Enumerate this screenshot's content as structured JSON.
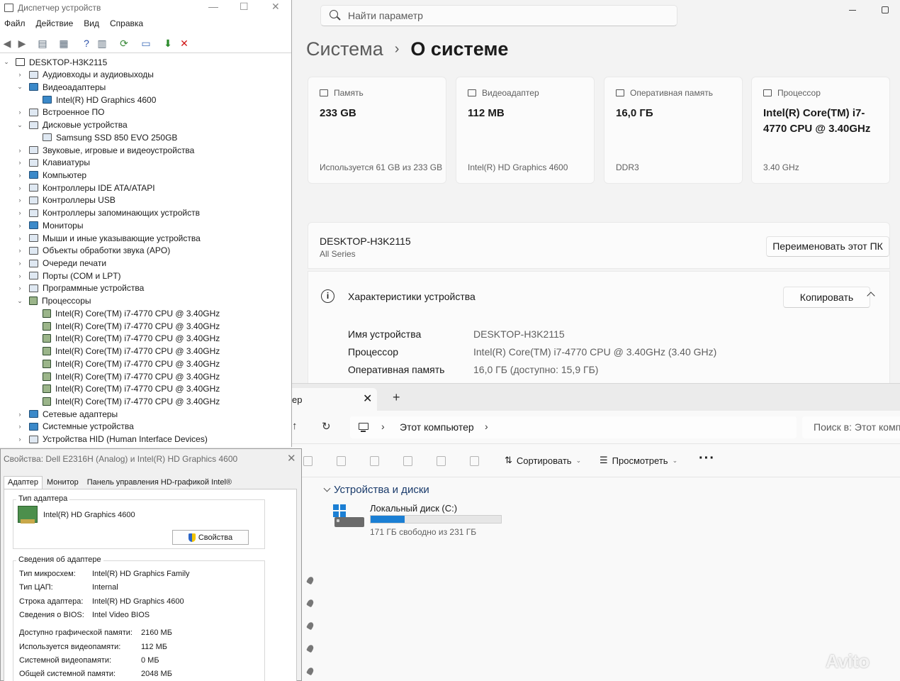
{
  "settings": {
    "search_placeholder": "Найти параметр",
    "breadcrumb_parent": "Система",
    "breadcrumb_sep": "›",
    "breadcrumb_current": "О системе",
    "cards": [
      {
        "label": "Память",
        "value": "233 GB",
        "sub": "Используется 61 GB из 233 GB"
      },
      {
        "label": "Видеоадаптер",
        "value": "112 MB",
        "sub": "Intel(R) HD Graphics 4600"
      },
      {
        "label": "Оперативная память",
        "value": "16,0 ГБ",
        "sub": "DDR3"
      },
      {
        "label": "Процессор",
        "value": "Intel(R) Core(TM) i7-4770 CPU @ 3.40GHz",
        "sub": "3.40 GHz"
      }
    ],
    "device_name": "DESKTOP-H3K2115",
    "device_series": "All Series",
    "rename_button": "Переименовать этот ПК",
    "specs_title": "Характеристики устройства",
    "copy_button": "Копировать",
    "specs": [
      {
        "key": "Имя устройства",
        "value": "DESKTOP-H3K2115"
      },
      {
        "key": "Процессор",
        "value": "Intel(R) Core(TM) i7-4770 CPU @ 3.40GHz (3.40 GHz)"
      },
      {
        "key": "Оперативная память",
        "value": "16,0 ГБ (доступно: 15,9 ГБ)"
      }
    ]
  },
  "explorer": {
    "tab_title": "ер",
    "path_item": "Этот компьютер",
    "search_placeholder": "Поиск в: Этот комп",
    "sort_label": "Сортировать",
    "view_label": "Просмотреть",
    "group_title": "Устройства и диски",
    "drive_name": "Локальный диск (C:)",
    "drive_free": "171 ГБ свободно из 231 ГБ",
    "drive_used_fraction": 0.26,
    "accent": "#1b7fd4"
  },
  "devmgr": {
    "title": "Диспетчер устройств",
    "menu": [
      "Файл",
      "Действие",
      "Вид",
      "Справка"
    ],
    "tree": [
      {
        "label": "DESKTOP-H3K2115",
        "indent": 0,
        "twisty": "v",
        "icon": "pc"
      },
      {
        "label": "Аудиовходы и аудиовыходы",
        "indent": 1,
        "twisty": ">",
        "icon": "gen"
      },
      {
        "label": "Видеоадаптеры",
        "indent": 1,
        "twisty": "v",
        "icon": "disp"
      },
      {
        "label": "Intel(R) HD Graphics 4600",
        "indent": 2,
        "twisty": "",
        "icon": "disp"
      },
      {
        "label": "Встроенное ПО",
        "indent": 1,
        "twisty": ">",
        "icon": "gen"
      },
      {
        "label": "Дисковые устройства",
        "indent": 1,
        "twisty": "v",
        "icon": "gen"
      },
      {
        "label": "Samsung SSD 850 EVO 250GB",
        "indent": 2,
        "twisty": "",
        "icon": "gen"
      },
      {
        "label": "Звуковые, игровые и видеоустройства",
        "indent": 1,
        "twisty": ">",
        "icon": "gen"
      },
      {
        "label": "Клавиатуры",
        "indent": 1,
        "twisty": ">",
        "icon": "gen"
      },
      {
        "label": "Компьютер",
        "indent": 1,
        "twisty": ">",
        "icon": "disp"
      },
      {
        "label": "Контроллеры IDE ATA/ATAPI",
        "indent": 1,
        "twisty": ">",
        "icon": "gen"
      },
      {
        "label": "Контроллеры USB",
        "indent": 1,
        "twisty": ">",
        "icon": "gen"
      },
      {
        "label": "Контроллеры запоминающих устройств",
        "indent": 1,
        "twisty": ">",
        "icon": "gen"
      },
      {
        "label": "Мониторы",
        "indent": 1,
        "twisty": ">",
        "icon": "disp"
      },
      {
        "label": "Мыши и иные указывающие устройства",
        "indent": 1,
        "twisty": ">",
        "icon": "gen"
      },
      {
        "label": "Объекты обработки звука (APO)",
        "indent": 1,
        "twisty": ">",
        "icon": "gen"
      },
      {
        "label": "Очереди печати",
        "indent": 1,
        "twisty": ">",
        "icon": "gen"
      },
      {
        "label": "Порты (COM и LPT)",
        "indent": 1,
        "twisty": ">",
        "icon": "gen"
      },
      {
        "label": "Программные устройства",
        "indent": 1,
        "twisty": ">",
        "icon": "gen"
      },
      {
        "label": "Процессоры",
        "indent": 1,
        "twisty": "v",
        "icon": "cpu"
      },
      {
        "label": "Intel(R) Core(TM) i7-4770 CPU @ 3.40GHz",
        "indent": 2,
        "twisty": "",
        "icon": "cpu"
      },
      {
        "label": "Intel(R) Core(TM) i7-4770 CPU @ 3.40GHz",
        "indent": 2,
        "twisty": "",
        "icon": "cpu"
      },
      {
        "label": "Intel(R) Core(TM) i7-4770 CPU @ 3.40GHz",
        "indent": 2,
        "twisty": "",
        "icon": "cpu"
      },
      {
        "label": "Intel(R) Core(TM) i7-4770 CPU @ 3.40GHz",
        "indent": 2,
        "twisty": "",
        "icon": "cpu"
      },
      {
        "label": "Intel(R) Core(TM) i7-4770 CPU @ 3.40GHz",
        "indent": 2,
        "twisty": "",
        "icon": "cpu"
      },
      {
        "label": "Intel(R) Core(TM) i7-4770 CPU @ 3.40GHz",
        "indent": 2,
        "twisty": "",
        "icon": "cpu"
      },
      {
        "label": "Intel(R) Core(TM) i7-4770 CPU @ 3.40GHz",
        "indent": 2,
        "twisty": "",
        "icon": "cpu"
      },
      {
        "label": "Intel(R) Core(TM) i7-4770 CPU @ 3.40GHz",
        "indent": 2,
        "twisty": "",
        "icon": "cpu"
      },
      {
        "label": "Сетевые адаптеры",
        "indent": 1,
        "twisty": ">",
        "icon": "disp"
      },
      {
        "label": "Системные устройства",
        "indent": 1,
        "twisty": ">",
        "icon": "disp"
      },
      {
        "label": "Устройства HID (Human Interface Devices)",
        "indent": 1,
        "twisty": ">",
        "icon": "gen"
      }
    ]
  },
  "props": {
    "title": "Свойства: Dell E2316H (Analog) и Intel(R) HD Graphics 4600",
    "tabs": [
      "Адаптер",
      "Монитор",
      "Панель управления HD-графикой Intel®"
    ],
    "adapter_type_legend": "Тип адаптера",
    "adapter_name": "Intel(R) HD Graphics 4600",
    "properties_button": "Свойства",
    "info_legend": "Сведения об адаптере",
    "info": [
      {
        "key": "Тип микросхем:",
        "value": "Intel(R) HD Graphics Family"
      },
      {
        "key": "Тип ЦАП:",
        "value": "Internal"
      },
      {
        "key": "Строка адаптера:",
        "value": "Intel(R) HD Graphics 4600"
      },
      {
        "key": "Сведения о BIOS:",
        "value": "Intel Video BIOS"
      }
    ],
    "memory": [
      {
        "key": "Доступно графической памяти:",
        "value": "2160 МБ"
      },
      {
        "key": "Используется видеопамяти:",
        "value": "112 МБ"
      },
      {
        "key": "Системной видеопамяти:",
        "value": "0 МБ"
      },
      {
        "key": "Общей системной памяти:",
        "value": "2048 МБ"
      }
    ]
  },
  "watermark": "Avito"
}
